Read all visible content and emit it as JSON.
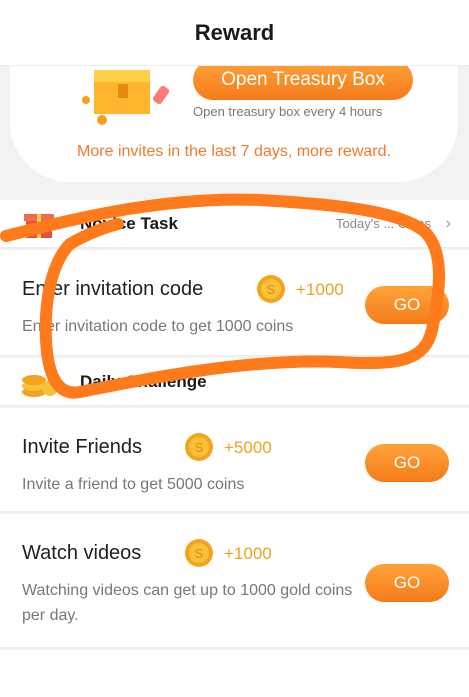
{
  "header": {
    "title": "Reward"
  },
  "treasury": {
    "button_label": "Open Treasury Box",
    "subtext": "Open treasury box every 4 hours",
    "invite_note": "More invites in the last 7 days, more reward."
  },
  "novice_section": {
    "title": "Novice Task",
    "right_text": "Today's ... Coins",
    "chevron": "›"
  },
  "daily_section": {
    "title": "Daily Challenge"
  },
  "tasks": [
    {
      "title": "Enter invitation code",
      "reward": "+1000",
      "description": "Enter invitation code to get 1000 coins",
      "button": "GO"
    },
    {
      "title": "Invite Friends",
      "reward": "+5000",
      "description": "Invite a friend to get 5000 coins",
      "button": "GO"
    },
    {
      "title": "Watch videos",
      "reward": "+1000",
      "description": "Watching videos can get up to 1000 gold coins per day.",
      "button": "GO"
    }
  ],
  "colors": {
    "accent": "#f47b1a",
    "reward_text": "#f0a020",
    "annotation": "#ff7a1a"
  },
  "icons": {
    "chest": "treasure-chest-icon",
    "coin": "gold-coin-icon",
    "gift": "gift-icon",
    "coins_stack": "coin-stack-icon"
  }
}
